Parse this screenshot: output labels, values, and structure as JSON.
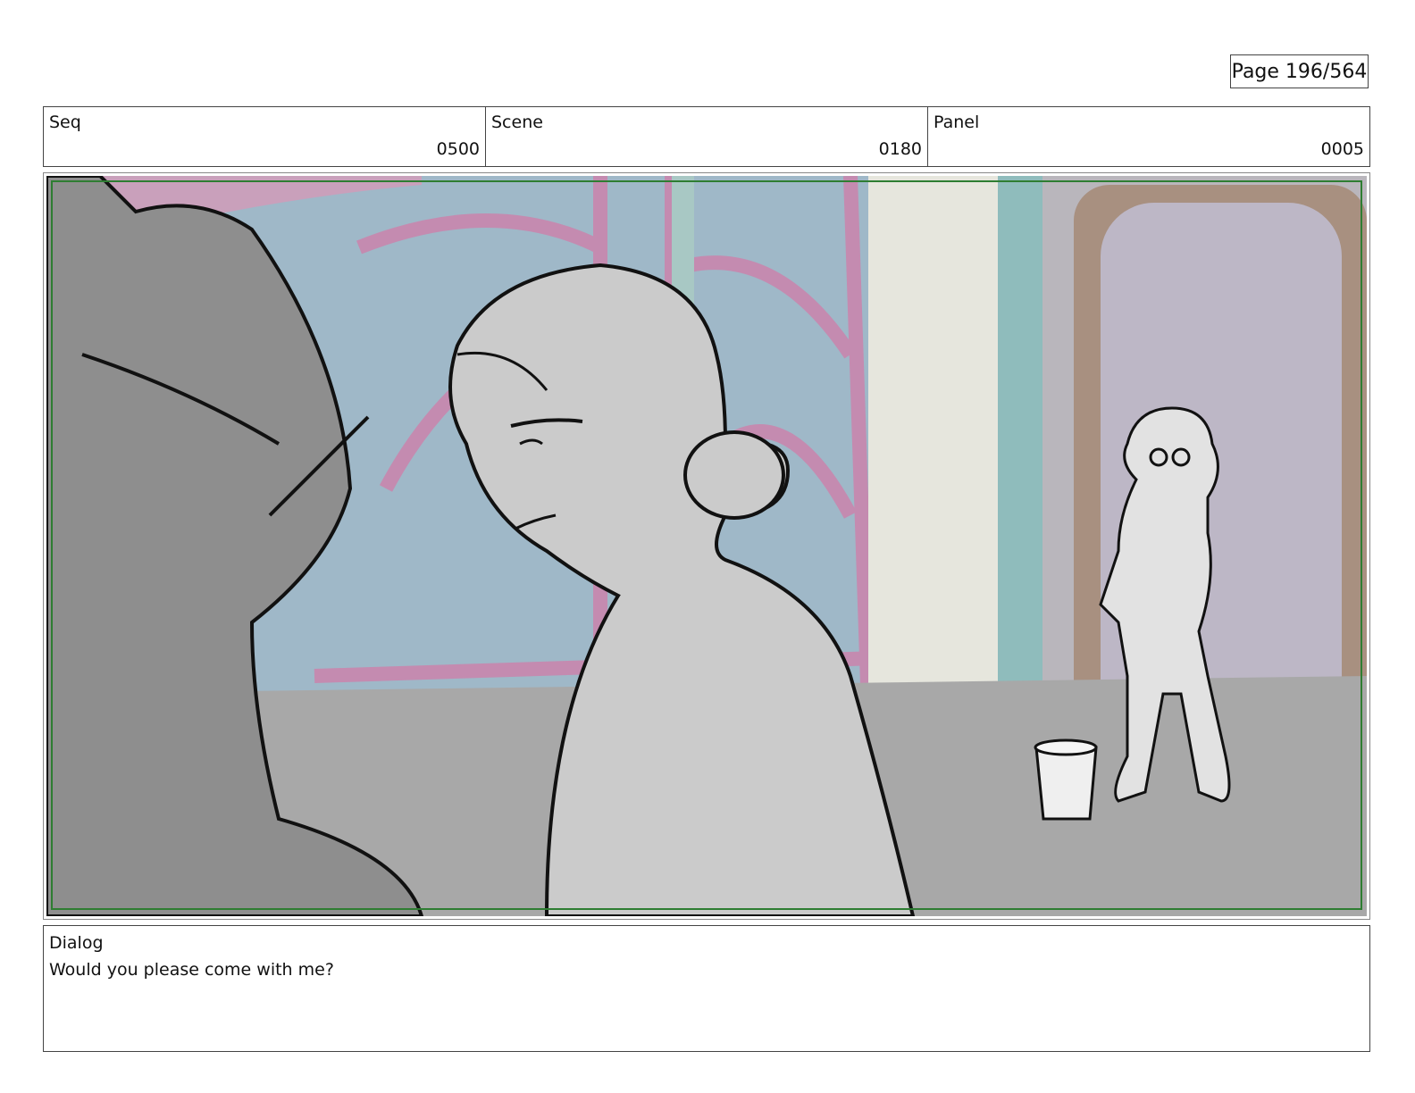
{
  "page": {
    "number": "Page 196/564"
  },
  "header": {
    "seq_label": "Seq",
    "seq_value": "0500",
    "scene_label": "Scene",
    "scene_value": "0180",
    "panel_label": "Panel",
    "panel_value": "0005"
  },
  "dialog": {
    "label": "Dialog",
    "text": "Would you please come with me?"
  },
  "colors": {
    "safe_frame": "#2e7d32",
    "window_pink": "#c48bb0",
    "sky_blue": "#9fb8c8",
    "pillar_teal": "#8fbcbc",
    "floor_gray": "#a8a8a8",
    "door_brown": "#a89080"
  }
}
